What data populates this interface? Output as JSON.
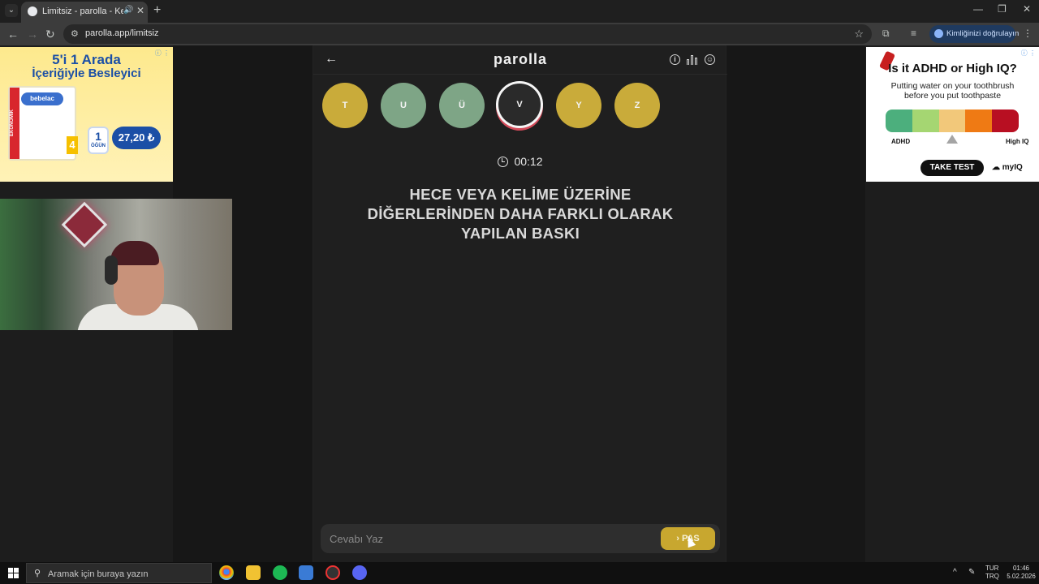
{
  "browser": {
    "tab_title": "Limitsiz - parolla - Kelime oyunu",
    "url": "parolla.app/limitsiz",
    "verify_label": "Kimliğinizi doğrulayın",
    "new_tab": "+",
    "tab_close": "✕",
    "minimize": "—",
    "restore": "❐",
    "close": "✕",
    "back": "←",
    "forward": "→",
    "reload": "↻",
    "star": "☆",
    "extensions": "⧉",
    "media": "≡",
    "menu": "⋮"
  },
  "app": {
    "title": "parolla",
    "back": "←",
    "info_icon_label": "i",
    "letters": [
      {
        "letter": "T",
        "state": "passed",
        "color": "#c9ab3a"
      },
      {
        "letter": "U",
        "state": "correct",
        "color": "#7ea586"
      },
      {
        "letter": "Ü",
        "state": "correct",
        "color": "#7ea586"
      },
      {
        "letter": "V",
        "state": "current",
        "color": "#2a2a2a"
      },
      {
        "letter": "Y",
        "state": "passed",
        "color": "#c9ab3a"
      },
      {
        "letter": "Z",
        "state": "passed",
        "color": "#c9ab3a"
      }
    ],
    "timer": "00:12",
    "question_lines": [
      "HECE VEYA KELİME ÜZERİNE",
      "DİĞERLERİNDEN DAHA FARKLI OLARAK",
      "YAPILAN BASKI"
    ],
    "answer_placeholder": "Cevabı Yaz",
    "pass_label": "› PAS"
  },
  "ad_left": {
    "headline1": "5'i 1 Arada",
    "headline2": "İçeriğiyle Besleyici",
    "brand": "bebelac",
    "band": "EKONOMİK",
    "stage": "4",
    "cup_number": "1",
    "cup_label": "ÖĞÜN",
    "price": "27,20 ₺",
    "info": "ⓘ ⋮"
  },
  "ad_right": {
    "question": "Is it ADHD or High IQ?",
    "subtitle1": "Putting water on your toothbrush",
    "subtitle2": "before you put toothpaste",
    "scale_colors": [
      "#4caf7d",
      "#a5d672",
      "#f2c87a",
      "#ef7a14",
      "#b80f22"
    ],
    "left_label": "ADHD",
    "right_label": "High IQ",
    "cta": "TAKE TEST",
    "logo": "myIQ",
    "info": "ⓘ ⋮"
  },
  "taskbar": {
    "search_placeholder": "Aramak için buraya yazın",
    "lang_top": "TUR",
    "lang_bottom": "TRQ",
    "time": "01:46",
    "date": "5.02.2026",
    "tray_chevron": "^"
  }
}
